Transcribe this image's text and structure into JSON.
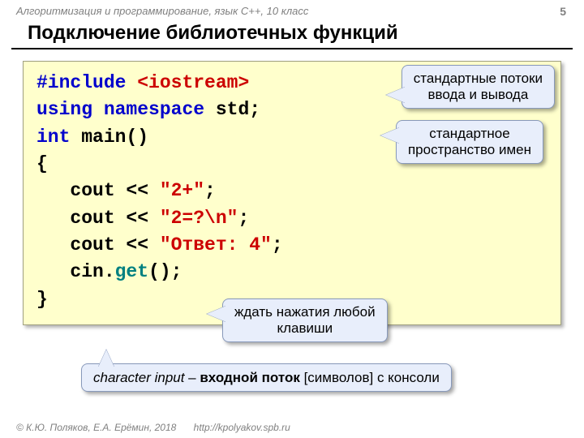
{
  "header": {
    "subtitle": "Алгоритмизация и программирование, язык  C++, 10 класс",
    "page": "5"
  },
  "title": "Подключение библиотечных функций",
  "code": {
    "l1a": "#include",
    "l1b": "<iostream>",
    "l2a": "using",
    "l2b": "namespace",
    "l2c": "std;",
    "l3a": "int",
    "l3b": "main()",
    "l4": "{",
    "l5a": "   cout << ",
    "l5b": "\"2+\"",
    "l5c": ";",
    "l6a": "   cout << ",
    "l6b": "\"2=?\\n\"",
    "l6c": ";",
    "l7a": "   cout << ",
    "l7b": "\"Ответ: 4\"",
    "l7c": ";",
    "l8a": "   cin.",
    "l8b": "get",
    "l8c": "();",
    "l9": "}"
  },
  "callouts": {
    "c1l1": "стандартные потоки",
    "c1l2": "ввода и вывода",
    "c2l1": "стандартное",
    "c2l2": "пространство имен",
    "c3l1": "ждать нажатия любой",
    "c3l2": "клавиши",
    "bottom_i": "character input",
    "bottom_dash": " – ",
    "bottom_b": "входной поток",
    "bottom_rest": " [символов] с консоли"
  },
  "footer": {
    "copy": "© К.Ю. Поляков, Е.А. Ерёмин, 2018",
    "url": "http://kpolyakov.spb.ru"
  }
}
